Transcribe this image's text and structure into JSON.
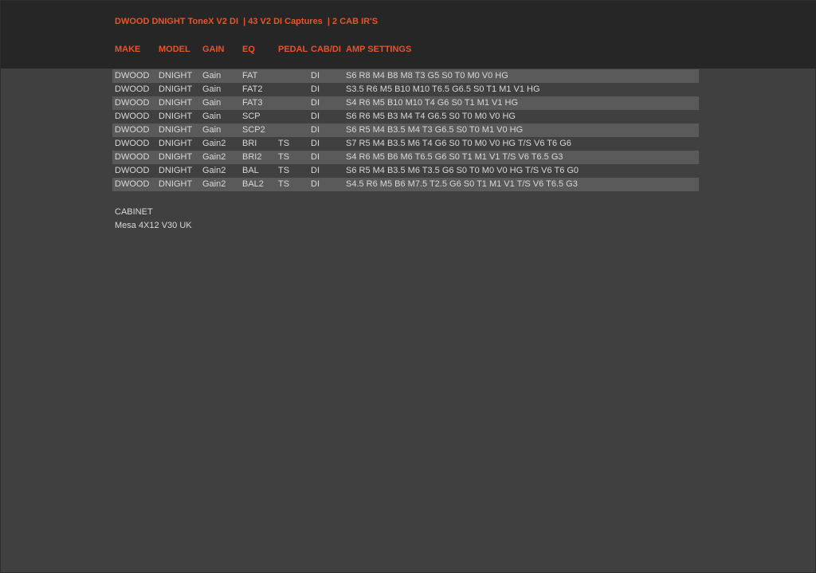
{
  "header": {
    "title": "DWOOD DNIGHT ToneX V2 DI  | 43 V2 DI Captures  | 2 CAB IR'S",
    "columns": {
      "make": "MAKE",
      "model": "MODEL",
      "gain": "GAIN",
      "eq": "EQ",
      "pedal": "PEDAL",
      "cabdi": "CAB/DI",
      "amp": "AMP SETTINGS"
    }
  },
  "rows": [
    {
      "make": "DWOOD",
      "model": "DNIGHT",
      "gain": "Gain",
      "eq": "FAT",
      "pedal": "",
      "cabdi": "DI",
      "amp": "S6 R8 M4 B8 M8 T3 G5 S0 T0 M0 V0 HG"
    },
    {
      "make": "DWOOD",
      "model": "DNIGHT",
      "gain": "Gain",
      "eq": "FAT2",
      "pedal": "",
      "cabdi": "DI",
      "amp": "S3.5 R6 M5 B10 M10 T6.5 G6.5 S0 T1 M1 V1 HG"
    },
    {
      "make": "DWOOD",
      "model": "DNIGHT",
      "gain": "Gain",
      "eq": "FAT3",
      "pedal": "",
      "cabdi": "DI",
      "amp": "S4 R6 M5 B10 M10 T4 G6 S0 T1 M1 V1 HG"
    },
    {
      "make": "DWOOD",
      "model": "DNIGHT",
      "gain": "Gain",
      "eq": "SCP",
      "pedal": "",
      "cabdi": "DI",
      "amp": "S6 R6 M5 B3 M4 T4 G6.5 S0 T0 M0 V0 HG"
    },
    {
      "make": "DWOOD",
      "model": "DNIGHT",
      "gain": "Gain",
      "eq": "SCP2",
      "pedal": "",
      "cabdi": "DI",
      "amp": "S6 R5 M4 B3.5 M4 T3 G6.5 S0 T0 M1 V0 HG"
    },
    {
      "make": "DWOOD",
      "model": "DNIGHT",
      "gain": "Gain2",
      "eq": "BRI",
      "pedal": "TS",
      "cabdi": "DI",
      "amp": "S7 R5 M4 B3.5 M6 T4 G6 S0 T0 M0 V0 HG T/S V6 T6 G6"
    },
    {
      "make": "DWOOD",
      "model": "DNIGHT",
      "gain": "Gain2",
      "eq": "BRI2",
      "pedal": "TS",
      "cabdi": "DI",
      "amp": "S4 R6 M5 B6 M6 T6.5 G6 S0 T1 M1 V1 T/S V6 T6.5 G3"
    },
    {
      "make": "DWOOD",
      "model": "DNIGHT",
      "gain": "Gain2",
      "eq": "BAL",
      "pedal": "TS",
      "cabdi": "DI",
      "amp": "S6 R5 M4 B3.5 M6 T3.5 G6 S0 T0 M0 V0 HG T/S V6 T6 G0"
    },
    {
      "make": "DWOOD",
      "model": "DNIGHT",
      "gain": "Gain2",
      "eq": "BAL2",
      "pedal": "TS",
      "cabdi": "DI",
      "amp": "S4.5 R6 M5 B6 M7.5 T2.5 G6 S0 T1 M1 V1 T/S V6 T6.5 G3"
    }
  ],
  "cabinet": {
    "label": "CABINET",
    "value": "Mesa 4X12 V30 UK"
  },
  "colors": {
    "accent": "#e8542a",
    "header_bg": "#262626",
    "page_bg": "#404040",
    "row_alt_bg": "#5a5a5a",
    "text": "#d8d8d8"
  }
}
